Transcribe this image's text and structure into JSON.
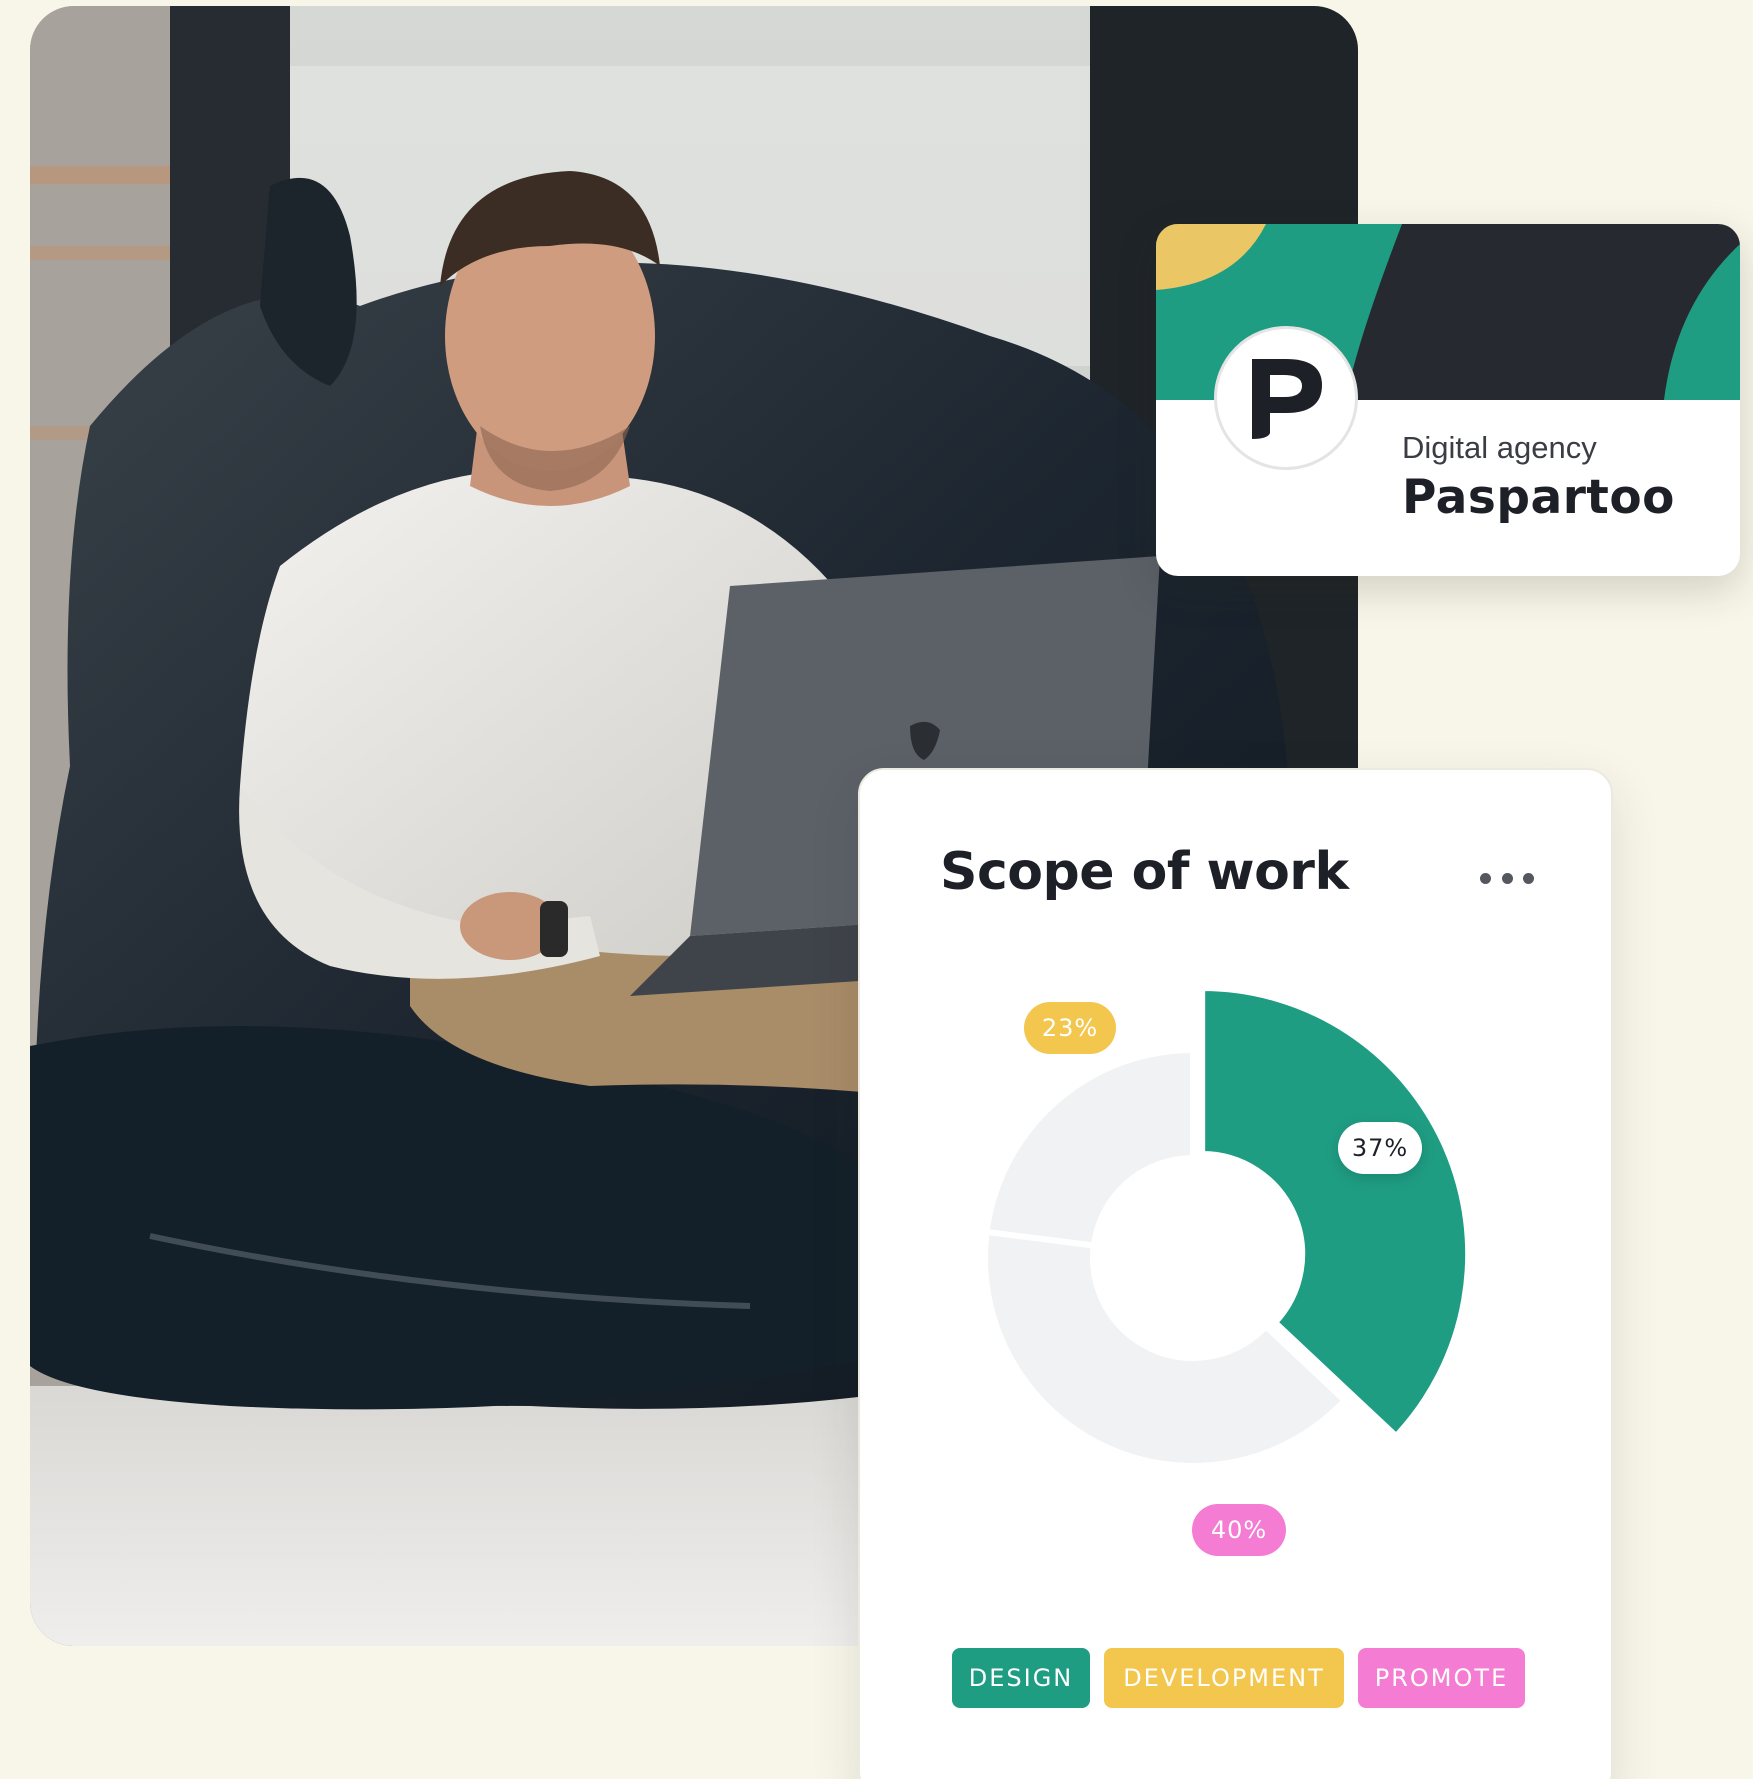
{
  "agency": {
    "type": "Digital agency",
    "name": "Paspartoo",
    "logo_letter": "P",
    "colors": {
      "banner": "#262930",
      "green": "#1f9d83",
      "yellow": "#ebc665"
    }
  },
  "scope": {
    "title": "Scope of work"
  },
  "chart_data": {
    "type": "pie",
    "categories": [
      "DESIGN",
      "DEVELOPMENT",
      "PROMOTE"
    ],
    "values": [
      37,
      23,
      40
    ],
    "labels": [
      "37%",
      "23%",
      "40%"
    ],
    "colors": [
      "#1f9d83",
      "#f3c64d",
      "#f57cd3"
    ],
    "highlighted": "DESIGN",
    "legend_position": "bottom"
  },
  "photo": {
    "icon": "person-with-laptop-photo"
  }
}
